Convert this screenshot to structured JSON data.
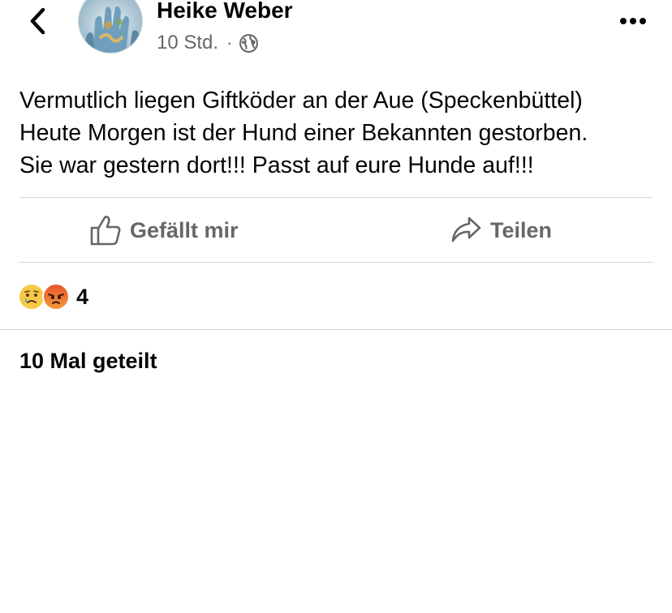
{
  "post": {
    "author": "Heike Weber",
    "time": "10 Std.",
    "separator": "·",
    "text_lines": [
      "Vermutlich liegen Giftköder an der Aue (Speckenbüttel)",
      "Heute Morgen ist der Hund einer Bekannten gestorben.",
      "Sie war gestern dort!!! Passt auf eure Hunde auf!!!"
    ]
  },
  "icons": {
    "back": "chevron-left-icon",
    "more": "more-dots-icon",
    "privacy": "globe-icon",
    "like": "thumbs-up-icon",
    "share": "share-arrow-icon",
    "reactions": [
      "sad-reaction-icon",
      "angry-reaction-icon"
    ]
  },
  "actions": {
    "like_label": "Gefällt mir",
    "share_label": "Teilen"
  },
  "reactions": {
    "count": "4"
  },
  "shares": {
    "label": "10 Mal geteilt"
  },
  "colors": {
    "text": "#050505",
    "secondary": "#65676b",
    "divider": "#d4d6da",
    "sad_emoji": "#f7c948",
    "angry_emoji": "#e8552d"
  }
}
